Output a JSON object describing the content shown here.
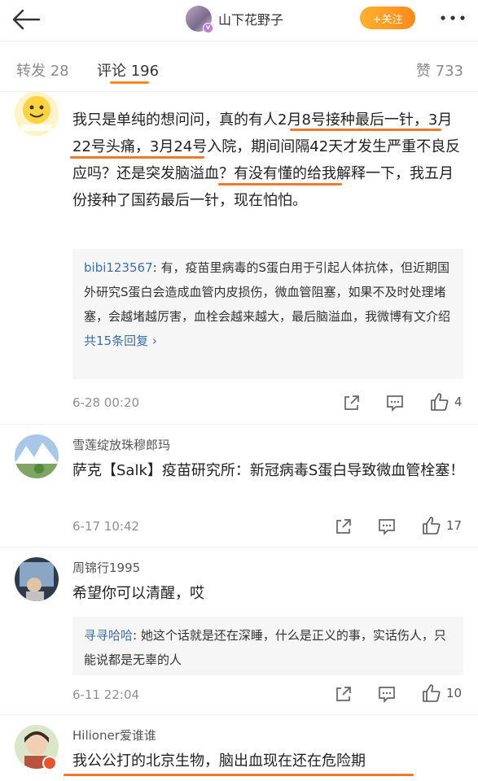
{
  "header": {
    "back_icon": "back-arrow-icon",
    "username": "山下花野子",
    "follow_label": "+关注",
    "more_icon": "more-dots-icon"
  },
  "tabs": {
    "repost": "转发 28",
    "comment": "评论 196",
    "like": "赞 733",
    "accent": "#ff8a1c"
  },
  "comments": [
    {
      "name": "",
      "text": "我只是单纯的想问问，真的有人2月8号接种最后一针，3月22号头痛，3月24号入院，期间间隔42天才发生严重不良反应吗？还是突发脑溢血？有没有懂的给我解释一下，我五月份接种了国药最后一针，现在怕怕。",
      "reply_user": "bibi123567",
      "reply_text": ": 有，疫苗里病毒的S蛋白用于引起人体抗体，但近期国外研究S蛋白会造成血管内皮损伤，微血管阻塞，如果不及时处理堵塞，会越堵越厉害，血栓会越来越大，最后脑溢血，我微博有文介绍",
      "reply_more": "共15条回复 ›",
      "time": "6-28 00:20",
      "likes": "4"
    },
    {
      "name": "雪莲绽放珠穆郎玛",
      "text": "萨克【Salk】疫苗研究所：新冠病毒S蛋白导致微血管栓塞！",
      "time": "6-17 10:42",
      "likes": "17"
    },
    {
      "name": "周锦行1995",
      "text": "希望你可以清醒，哎",
      "reply_user": "寻寻哈哈",
      "reply_text": ": 她这个话就是还在深睡，什么是正义的事，实话伤人，只能说都是无辜的人",
      "time": "6-11 22:04",
      "likes": "10"
    },
    {
      "name": "Hilioner爱谁谁",
      "text": "我公公打的北京生物，脑出血现在还在危险期"
    }
  ],
  "colors": {
    "highlight": "#ec7a2b",
    "link": "#3e6fa5",
    "reply_bg": "#f6f6f6"
  }
}
